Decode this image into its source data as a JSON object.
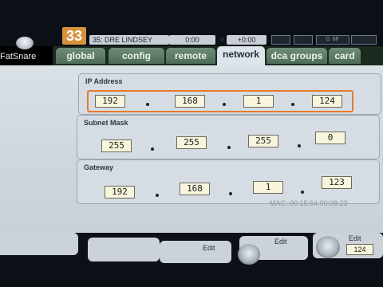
{
  "topbar": {
    "scene_number": "33",
    "scene_name": "35: DRE LINDSEY",
    "time_a": "0:00",
    "time_b": "+0:00",
    "meter_text": "0.  6F"
  },
  "channel": {
    "name": "FatSnare"
  },
  "tabs": [
    {
      "label": "global",
      "active": false
    },
    {
      "label": "config",
      "active": false
    },
    {
      "label": "remote",
      "active": false
    },
    {
      "label": "network",
      "active": true
    },
    {
      "label": "dca groups",
      "active": false
    },
    {
      "label": "card",
      "active": false
    }
  ],
  "network": {
    "ip": {
      "title": "IP Address",
      "octets": [
        "192",
        "168",
        "1",
        "124"
      ]
    },
    "subnet": {
      "title": "Subnet Mask",
      "octets": [
        "255",
        "255",
        "255",
        "0"
      ]
    },
    "gateway": {
      "title": "Gateway",
      "octets": [
        "192",
        "168",
        "1",
        "123"
      ]
    },
    "mac": "MAC: 00:15:64:00:08:23"
  },
  "bottom": {
    "edit_label": "Edit",
    "value": "124"
  },
  "colors": {
    "highlight": "#e47a2c",
    "scene_badge": "#d7923c",
    "tab_active": "#dde4ea",
    "tab_inactive": "#5f7c69"
  }
}
